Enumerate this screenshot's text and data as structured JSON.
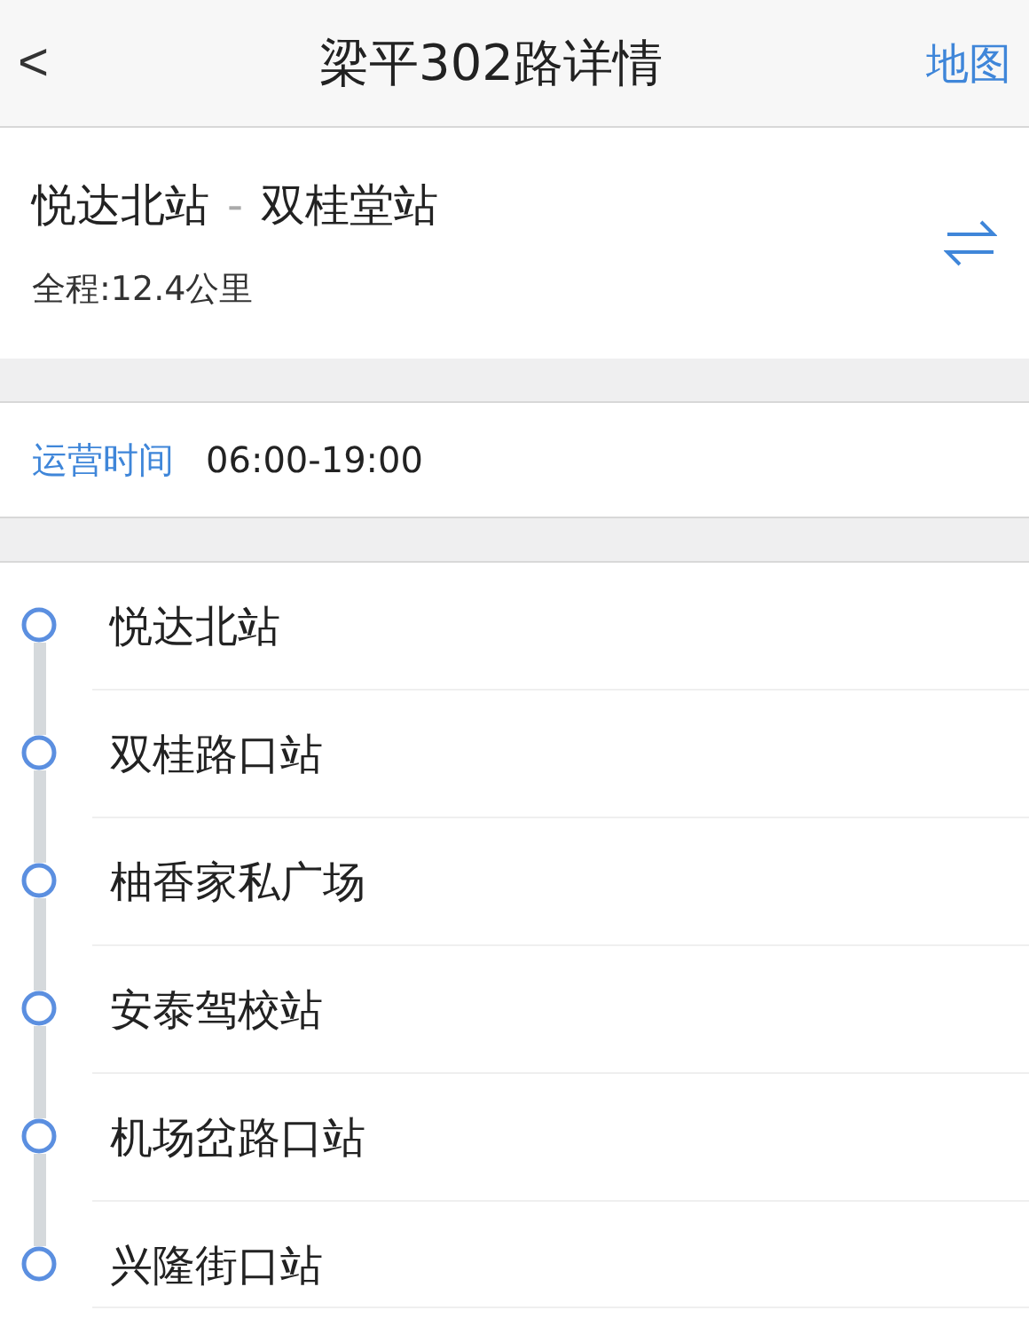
{
  "header": {
    "back": "<",
    "title": "梁平302路详情",
    "map_link": "地图"
  },
  "route": {
    "from": "悦达北站",
    "separator": "-",
    "to": "双桂堂站",
    "distance": "全程:12.4公里"
  },
  "hours": {
    "label": "运营时间",
    "value": "06:00-19:00"
  },
  "stops": [
    {
      "name": "悦达北站"
    },
    {
      "name": "双桂路口站"
    },
    {
      "name": "柚香家私广场"
    },
    {
      "name": "安泰驾校站"
    },
    {
      "name": "机场岔路口站"
    },
    {
      "name": "兴隆街口站"
    }
  ]
}
